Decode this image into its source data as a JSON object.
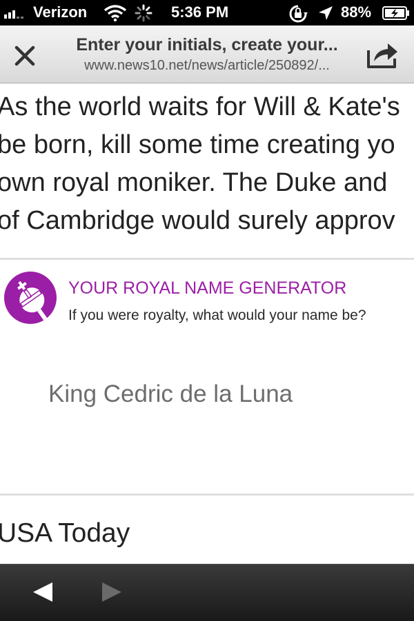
{
  "status_bar": {
    "carrier": "Verizon",
    "time": "5:36 PM",
    "battery": "88%"
  },
  "browser": {
    "page_title": "Enter your initials, create your...",
    "url": "www.news10.net/news/article/250892/..."
  },
  "article": {
    "lines": [
      "As the world waits for Will & Kate's",
      "be born, kill some time creating yo",
      "own royal moniker. The Duke and",
      "of Cambridge would surely approv"
    ]
  },
  "widget": {
    "title": "YOUR ROYAL NAME GENERATOR",
    "subtitle": "If you were royalty, what would your name be?",
    "result": "King Cedric de la Luna",
    "accent_color": "#9b1fa6",
    "icon": "crown-orb-icon"
  },
  "source": {
    "label": "USA Today"
  },
  "toolbar": {
    "back_icon": "back-arrow-icon",
    "forward_icon": "forward-arrow-icon",
    "close_icon": "close-icon",
    "share_icon": "share-icon"
  }
}
